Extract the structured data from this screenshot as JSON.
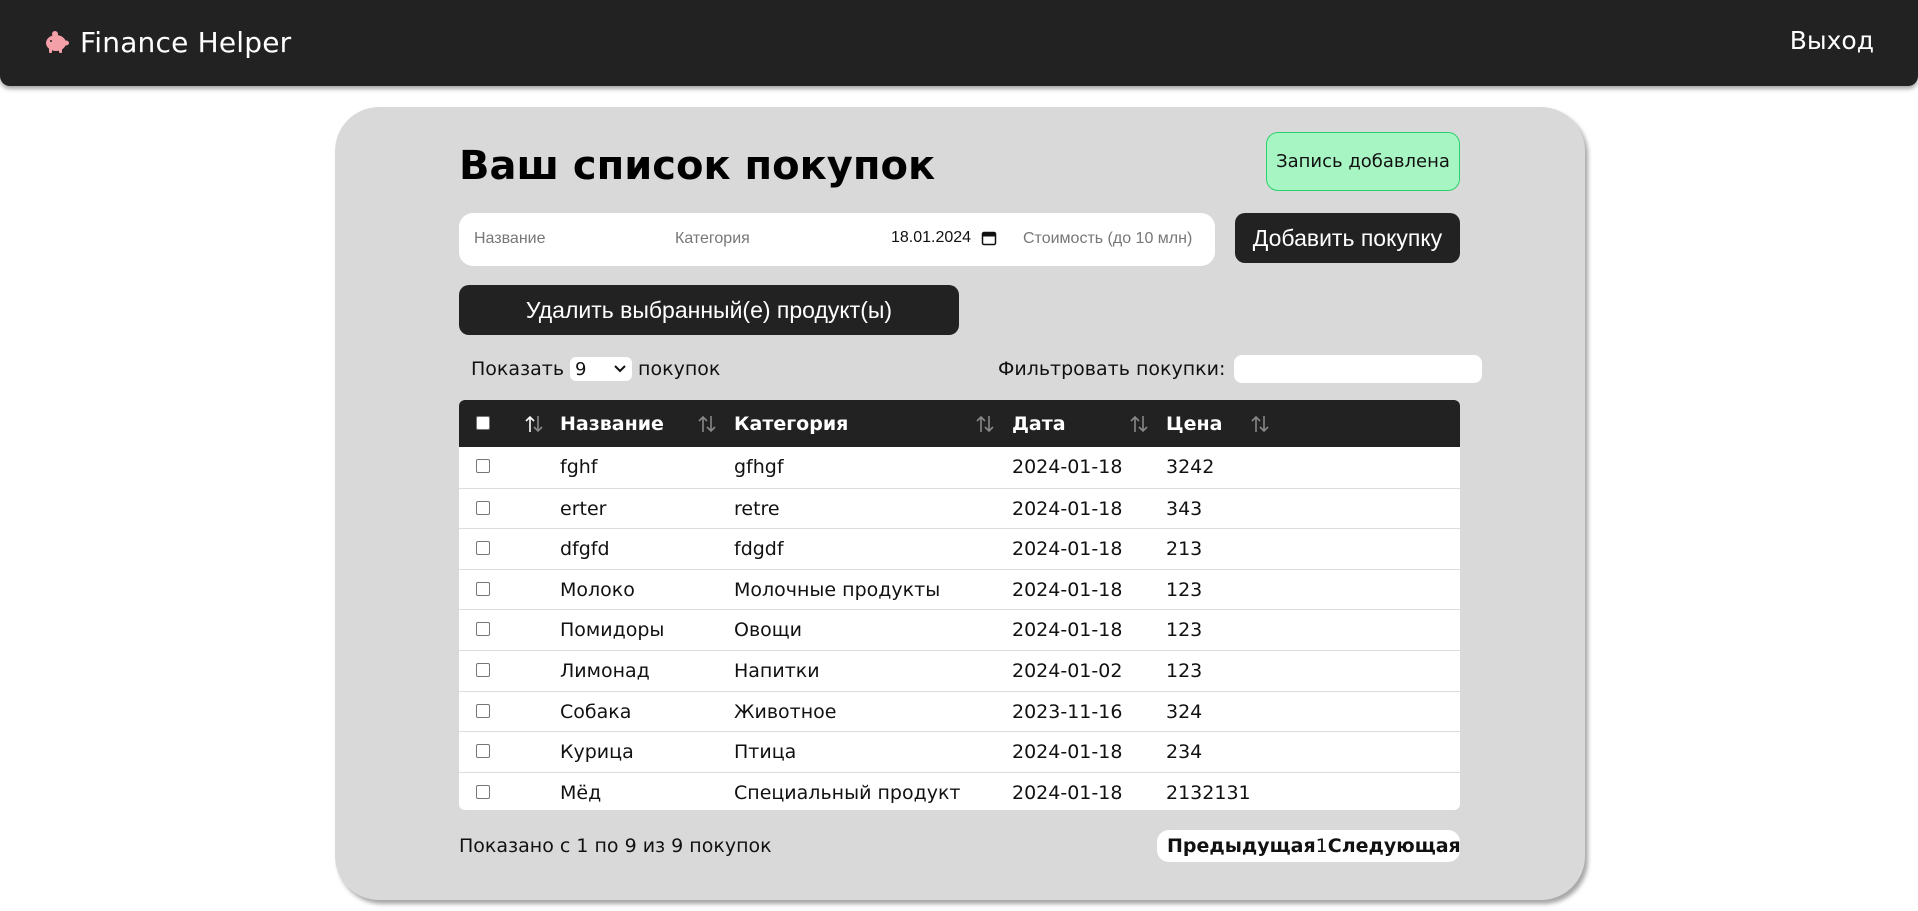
{
  "header": {
    "app_name": "Finance Helper",
    "logout_label": "Выход"
  },
  "main": {
    "title": "Ваш список покупок",
    "toast": "Запись добавлена",
    "form": {
      "name_placeholder": "Название",
      "category_placeholder": "Категория",
      "date_value": "18.01.2024",
      "cost_placeholder": "Стоимость (до 10 млн)"
    },
    "add_button": "Добавить покупку",
    "delete_button": "Удалить выбранный(е) продукт(ы)",
    "show": {
      "prefix": "Показать",
      "value": "9",
      "suffix": "покупок"
    },
    "filter_label": "Фильтровать покупки:",
    "table": {
      "columns": [
        "Название",
        "Категория",
        "Дата",
        "Цена"
      ],
      "rows": [
        {
          "name": "fghf",
          "category": "gfhgf",
          "date": "2024-01-18",
          "price": "3242"
        },
        {
          "name": "erter",
          "category": "retre",
          "date": "2024-01-18",
          "price": "343"
        },
        {
          "name": "dfgfd",
          "category": "fdgdf",
          "date": "2024-01-18",
          "price": "213"
        },
        {
          "name": "Молоко",
          "category": "Молочные продукты",
          "date": "2024-01-18",
          "price": "123"
        },
        {
          "name": "Помидоры",
          "category": "Овощи",
          "date": "2024-01-18",
          "price": "123"
        },
        {
          "name": "Лимонад",
          "category": "Напитки",
          "date": "2024-01-02",
          "price": "123"
        },
        {
          "name": "Собака",
          "category": "Животное",
          "date": "2023-11-16",
          "price": "324"
        },
        {
          "name": "Курица",
          "category": "Птица",
          "date": "2024-01-18",
          "price": "234"
        },
        {
          "name": "Мёд",
          "category": "Специальный продукт",
          "date": "2024-01-18",
          "price": "2132131"
        }
      ]
    },
    "footer_info": "Показано с 1 по 9 из 9 покупок",
    "pager": {
      "prev": "Предыдущая",
      "page": "1",
      "next": "Следующая"
    }
  },
  "colors": {
    "topbar": "#222222",
    "panel": "#d9d9d9",
    "toast_bg": "#a8f5c4",
    "toast_border": "#2bd16a",
    "brand_icon": "#f4a0a8"
  },
  "icons": [
    "piggy-bank-icon",
    "calendar-icon",
    "sort-icon",
    "chevron-down-icon"
  ]
}
